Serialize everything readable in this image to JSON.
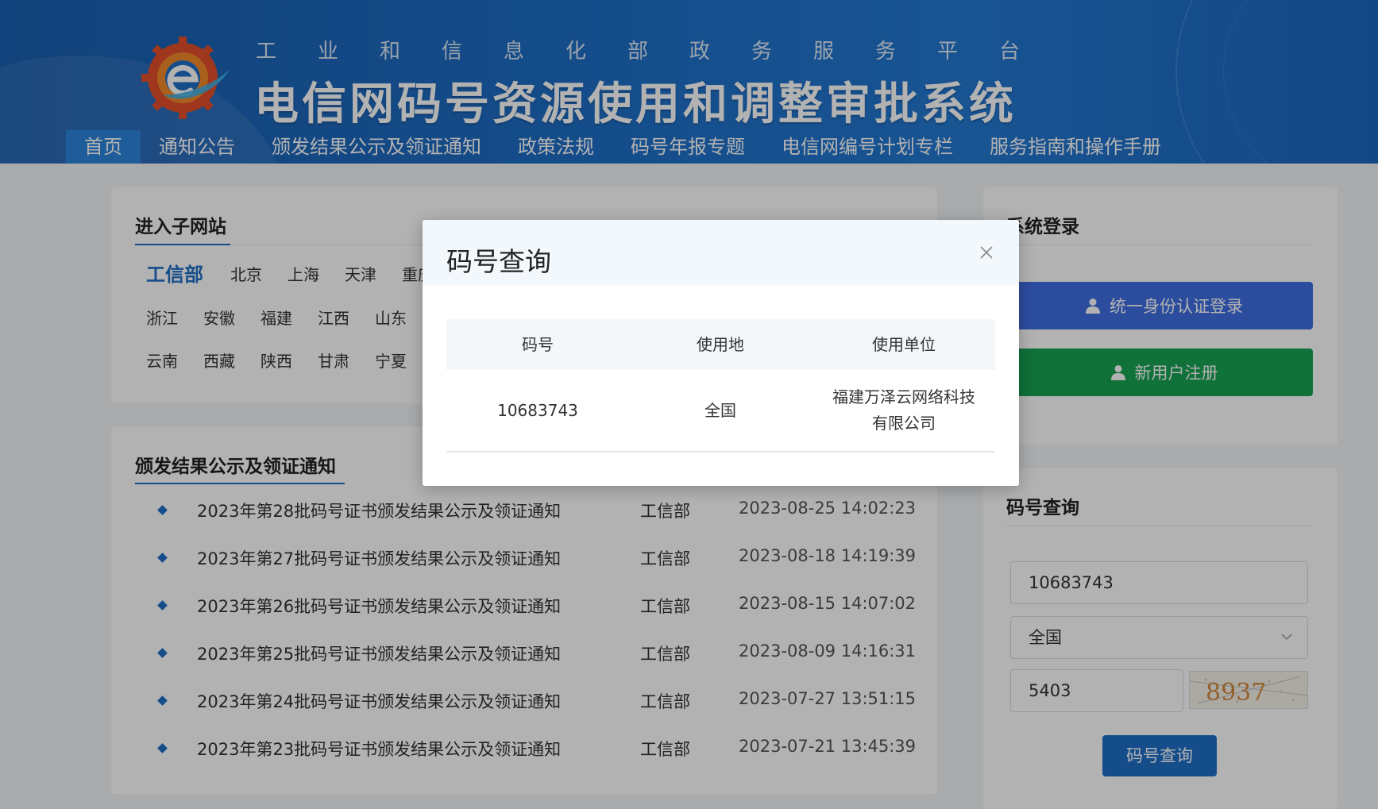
{
  "header": {
    "subtitle": "工业和信息化部政务服务平台",
    "title": "电信网码号资源使用和调整审批系统",
    "logo_icon": "e-gear-logo-icon",
    "nav": [
      {
        "label": "首页",
        "active": true
      },
      {
        "label": "通知公告"
      },
      {
        "label": "颁发结果公示及领证通知"
      },
      {
        "label": "政策法规"
      },
      {
        "label": "码号年报专题"
      },
      {
        "label": "电信网编号计划专栏"
      },
      {
        "label": "服务指南和操作手册"
      }
    ]
  },
  "subsites": {
    "title": "进入子网站",
    "items": [
      "工信部",
      "北京",
      "上海",
      "天津",
      "重庆",
      "浙江",
      "安徽",
      "福建",
      "江西",
      "山东",
      "云南",
      "西藏",
      "陕西",
      "甘肃",
      "宁夏"
    ]
  },
  "notices": {
    "title": "颁发结果公示及领证通知",
    "rows": [
      {
        "title": "2023年第28批码号证书颁发结果公示及领证通知",
        "dept": "工信部",
        "time": "2023-08-25 14:02:23"
      },
      {
        "title": "2023年第27批码号证书颁发结果公示及领证通知",
        "dept": "工信部",
        "time": "2023-08-18 14:19:39"
      },
      {
        "title": "2023年第26批码号证书颁发结果公示及领证通知",
        "dept": "工信部",
        "time": "2023-08-15 14:07:02"
      },
      {
        "title": "2023年第25批码号证书颁发结果公示及领证通知",
        "dept": "工信部",
        "time": "2023-08-09 14:16:31"
      },
      {
        "title": "2023年第24批码号证书颁发结果公示及领证通知",
        "dept": "工信部",
        "time": "2023-07-27 13:51:15"
      },
      {
        "title": "2023年第23批码号证书颁发结果公示及领证通知",
        "dept": "工信部",
        "time": "2023-07-21 13:45:39"
      }
    ]
  },
  "login": {
    "title": "系统登录",
    "unified_label": "统一身份认证登录",
    "register_label": "新用户注册",
    "login_color": "#3f6ee2",
    "register_color": "#17a352"
  },
  "query": {
    "title": "码号查询",
    "number_value": "10683743",
    "region_value": "全国",
    "captcha_value": "5403",
    "captcha_text": "8937",
    "button_label": "码号查询"
  },
  "modal": {
    "title": "码号查询",
    "columns": [
      "码号",
      "使用地",
      "使用单位"
    ],
    "rows": [
      {
        "number": "10683743",
        "region": "全国",
        "unit_line1": "福建万泽云网络科技",
        "unit_line2": "有限公司"
      }
    ]
  }
}
